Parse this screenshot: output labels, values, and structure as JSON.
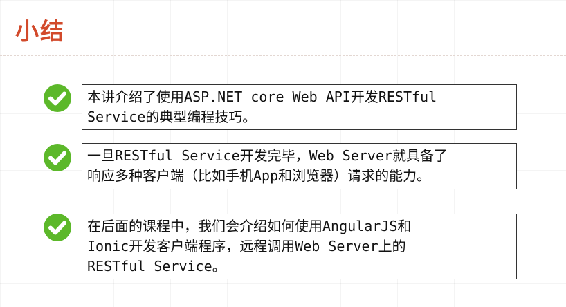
{
  "title": "小结",
  "items": [
    {
      "icon": "check-circle-icon",
      "lines": [
        "本讲介绍了使用ASP.NET core Web API开发RESTful",
        "Service的典型编程技巧。"
      ]
    },
    {
      "icon": "check-circle-icon",
      "lines": [
        "一旦RESTful Service开发完毕，Web Server就具备了",
        "响应多种客户端（比如手机App和浏览器）请求的能力。"
      ]
    },
    {
      "icon": "check-circle-icon",
      "lines": [
        "在后面的课程中，我们会介绍如何使用AngularJS和",
        "Ionic开发客户端程序，远程调用Web Server上的",
        "RESTful Service。"
      ]
    }
  ],
  "colors": {
    "title": "#d24a2b",
    "check": "#5cb82a",
    "border": "#333333"
  }
}
